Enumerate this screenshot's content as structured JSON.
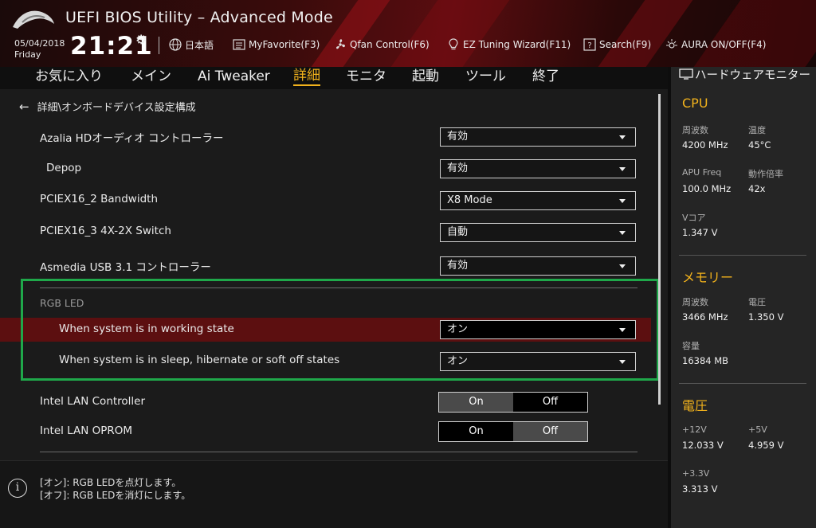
{
  "header": {
    "title": "UEFI BIOS Utility – Advanced Mode",
    "date": "05/04/2018",
    "day": "Friday",
    "time": "21:21",
    "tools": [
      {
        "label": "日本語",
        "icon": "globe-icon"
      },
      {
        "label": "MyFavorite(F3)",
        "icon": "favorite-list-icon"
      },
      {
        "label": "Qfan Control(F6)",
        "icon": "fan-icon"
      },
      {
        "label": "EZ Tuning Wizard(F11)",
        "icon": "lightbulb-icon"
      },
      {
        "label": "Search(F9)",
        "icon": "search-help-icon"
      },
      {
        "label": "AURA ON/OFF(F4)",
        "icon": "aura-icon"
      }
    ]
  },
  "nav": {
    "tabs": [
      "お気に入り",
      "メイン",
      "Ai Tweaker",
      "詳細",
      "モニタ",
      "起動",
      "ツール",
      "終了"
    ],
    "active": "詳細"
  },
  "main": {
    "breadcrumb": "詳細\\オンボードデバイス設定構成",
    "rows": [
      {
        "label": "Azalia HDオーディオ コントローラー",
        "value": "有効"
      },
      {
        "label": "Depop",
        "value": "有効"
      },
      {
        "label": "PCIEX16_2 Bandwidth",
        "value": "X8 Mode"
      },
      {
        "label": "PCIEX16_3 4X-2X Switch",
        "value": "自動"
      },
      {
        "label": "Asmedia USB 3.1 コントローラー",
        "value": "有効"
      }
    ],
    "rgb_section": {
      "header": "RGB LED",
      "rows": [
        {
          "label": "When system is in working state",
          "value": "オン"
        },
        {
          "label": "When system is in sleep, hibernate or soft off states",
          "value": "オン"
        }
      ]
    },
    "toggles": [
      {
        "label": "Intel LAN Controller",
        "on": "On",
        "off": "Off",
        "selected": "On"
      },
      {
        "label": "Intel LAN OPROM",
        "on": "On",
        "off": "Off",
        "selected": "Off"
      }
    ]
  },
  "help": {
    "lines": [
      "[オン]: RGB LEDを点灯します。",
      "[オフ]: RGB LEDを消灯にします。"
    ]
  },
  "monitor": {
    "title": "ハードウェアモニター",
    "cpu": {
      "title": "CPU",
      "freq_label": "周波数",
      "freq_value": "4200 MHz",
      "temp_label": "温度",
      "temp_value": "45°C",
      "apu_label": "APU Freq",
      "apu_value": "100.0 MHz",
      "ratio_label": "動作倍率",
      "ratio_value": "42x",
      "vcore_label": "Vコア",
      "vcore_value": "1.347 V"
    },
    "memory": {
      "title": "メモリー",
      "freq_label": "周波数",
      "freq_value": "3466 MHz",
      "volt_label": "電圧",
      "volt_value": "1.350 V",
      "cap_label": "容量",
      "cap_value": "16384 MB"
    },
    "voltage": {
      "title": "電圧",
      "v12_label": "+12V",
      "v12_value": "12.033 V",
      "v5_label": "+5V",
      "v5_value": "4.959 V",
      "v33_label": "+3.3V",
      "v33_value": "3.313 V"
    }
  },
  "colors": {
    "accent": "#f2b21c",
    "selected_row": "#5c0f10",
    "highlight_box": "#1fa84a"
  }
}
